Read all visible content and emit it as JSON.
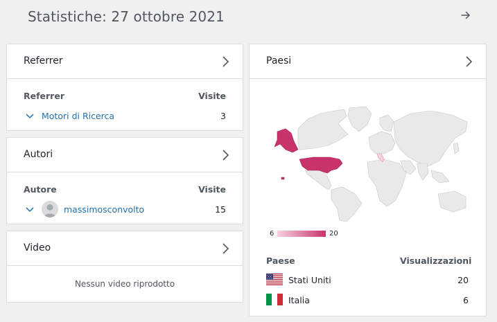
{
  "header": {
    "title": "Statistiche: 27 ottobre 2021"
  },
  "referrer": {
    "title": "Referrer",
    "col_left": "Referrer",
    "col_right": "Visite",
    "rows": [
      {
        "label": "Motori di Ricerca",
        "value": "3"
      }
    ]
  },
  "authors": {
    "title": "Autori",
    "col_left": "Autore",
    "col_right": "Visite",
    "rows": [
      {
        "label": "massimosconvolto",
        "value": "15"
      }
    ]
  },
  "video": {
    "title": "Video",
    "empty_text": "Nessun video riprodotto"
  },
  "countries": {
    "title": "Paesi",
    "legend_min": "6",
    "legend_max": "20",
    "col_left": "Paese",
    "col_right": "Visualizzazioni",
    "rows": [
      {
        "label": "Stati Uniti",
        "value": "20",
        "flag": "us-flag-icon"
      },
      {
        "label": "Italia",
        "value": "6",
        "flag": "it-flag-icon"
      }
    ],
    "colors": {
      "max": "#c9336b",
      "min": "#f6d2e0",
      "land": "#e9e9ea"
    }
  },
  "colors": {
    "link": "#2271b1",
    "border": "#dcdcde",
    "background": "#f0f0f1"
  }
}
